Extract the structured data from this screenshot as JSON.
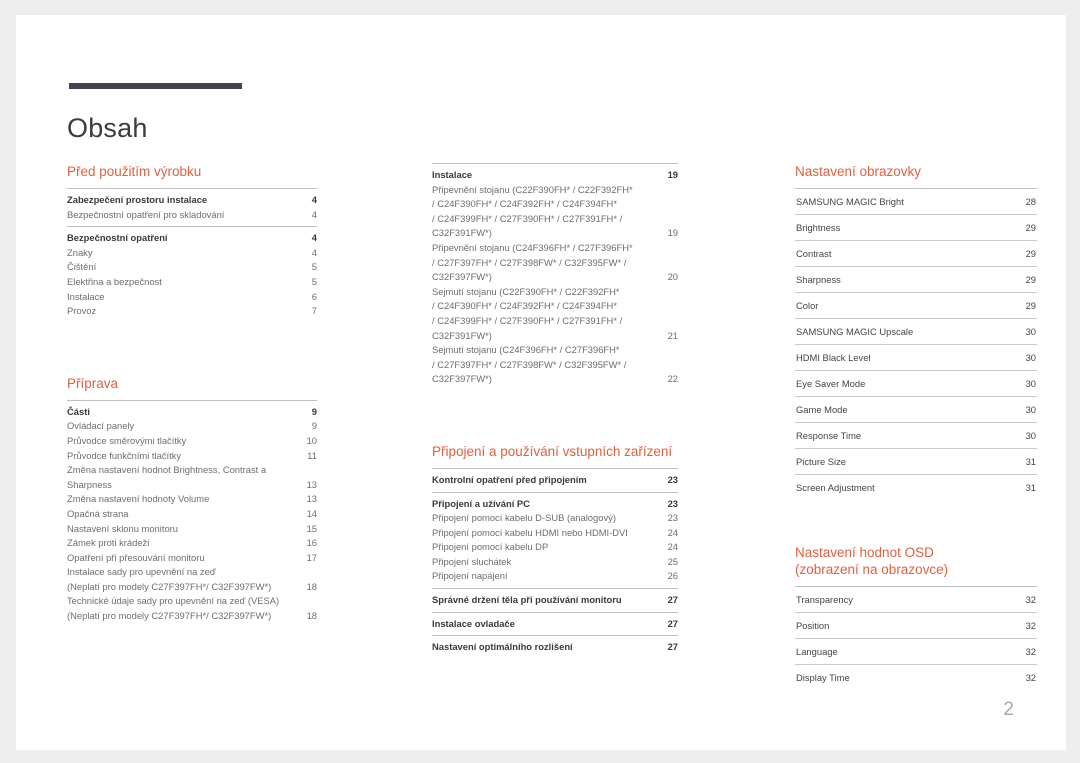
{
  "document": {
    "title": "Obsah",
    "page_number": "2",
    "accent_color": "#e0603d",
    "rule_color": "#464252"
  },
  "columns": [
    {
      "id": "column-1",
      "sections": [
        {
          "heading": "Před použitím výrobku",
          "groups": [
            {
              "entries": [
                {
                  "label": "Zabezpečení prostoru instalace",
                  "page": "4",
                  "level": 1
                },
                {
                  "label": "Bezpečnostní opatření pro skladování",
                  "page": "4",
                  "level": 2
                }
              ]
            },
            {
              "entries": [
                {
                  "label": "Bezpečnostní opatření",
                  "page": "4",
                  "level": 1
                },
                {
                  "label": "Znaky",
                  "page": "4",
                  "level": 2
                },
                {
                  "label": "Čištění",
                  "page": "5",
                  "level": 2
                },
                {
                  "label": "Elektřina a bezpečnost",
                  "page": "5",
                  "level": 2
                },
                {
                  "label": "Instalace",
                  "page": "6",
                  "level": 2
                },
                {
                  "label": "Provoz",
                  "page": "7",
                  "level": 2
                }
              ]
            }
          ]
        },
        {
          "heading": "Příprava",
          "groups": [
            {
              "entries": [
                {
                  "label": "Části",
                  "page": "9",
                  "level": 1
                },
                {
                  "label": "Ovládací panely",
                  "page": "9",
                  "level": 2
                },
                {
                  "label": "Průvodce směrovými tlačítky",
                  "page": "10",
                  "level": 2
                },
                {
                  "label": "Průvodce funkčními tlačítky",
                  "page": "11",
                  "level": 2
                },
                {
                  "label": "Změna nastavení hodnot Brightness, Contrast a\nSharpness",
                  "page": "13",
                  "level": 2
                },
                {
                  "label": "Změna nastavení hodnoty Volume",
                  "page": "13",
                  "level": 2
                },
                {
                  "label": "Opačná strana",
                  "page": "14",
                  "level": 2
                },
                {
                  "label": "Nastavení sklonu monitoru",
                  "page": "15",
                  "level": 2
                },
                {
                  "label": "Zámek proti krádeži",
                  "page": "16",
                  "level": 2
                },
                {
                  "label": "Opatření při přesouvání monitoru",
                  "page": "17",
                  "level": 2
                },
                {
                  "label": "Instalace sady pro upevnění na zeď\n(Neplatí pro modely C27F397FH*/ C32F397FW*)",
                  "page": "18",
                  "level": 2
                },
                {
                  "label": "Technické údaje sady pro upevnění na zeď (VESA)\n(Neplatí pro modely C27F397FH*/ C32F397FW*)",
                  "page": "18",
                  "level": 2
                }
              ]
            }
          ]
        }
      ]
    },
    {
      "id": "column-2",
      "sections": [
        {
          "heading": "",
          "groups": [
            {
              "entries": [
                {
                  "label": "Instalace",
                  "page": "19",
                  "level": 1
                },
                {
                  "label": "Připevnění stojanu (C22F390FH* / C22F392FH*\n/ C24F390FH* / C24F392FH* / C24F394FH*\n/ C24F399FH* / C27F390FH* / C27F391FH* /\nC32F391FW*)",
                  "page": "19",
                  "level": 2
                },
                {
                  "label": "Připevnění stojanu (C24F396FH* / C27F396FH*\n/ C27F397FH* / C27F398FW* / C32F395FW* /\nC32F397FW*)",
                  "page": "20",
                  "level": 2
                },
                {
                  "label": "Sejmutí stojanu (C22F390FH* / C22F392FH*\n/ C24F390FH* / C24F392FH* / C24F394FH*\n/ C24F399FH* / C27F390FH* / C27F391FH* /\nC32F391FW*)",
                  "page": "21",
                  "level": 2
                },
                {
                  "label": "Sejmutí stojanu (C24F396FH* / C27F396FH*\n/ C27F397FH* / C27F398FW* / C32F395FW* /\nC32F397FW*)",
                  "page": "22",
                  "level": 2
                }
              ]
            }
          ]
        },
        {
          "heading": "Připojení a používání vstupních zařízení",
          "groups": [
            {
              "entries": [
                {
                  "label": "Kontrolní opatření před připojením",
                  "page": "23",
                  "level": 1
                }
              ]
            },
            {
              "entries": [
                {
                  "label": "Připojení a užívání PC",
                  "page": "23",
                  "level": 1
                },
                {
                  "label": "Připojení pomocí kabelu D-SUB (analogový)",
                  "page": "23",
                  "level": 2
                },
                {
                  "label": "Připojení pomocí kabelu HDMI nebo HDMI-DVI",
                  "page": "24",
                  "level": 2
                },
                {
                  "label": "Připojení pomocí kabelu DP",
                  "page": "24",
                  "level": 2
                },
                {
                  "label": "Připojení sluchátek",
                  "page": "25",
                  "level": 2
                },
                {
                  "label": "Připojení napájení",
                  "page": "26",
                  "level": 2
                }
              ]
            },
            {
              "entries": [
                {
                  "label": "Správné držení těla při používání monitoru",
                  "page": "27",
                  "level": 1
                }
              ]
            },
            {
              "entries": [
                {
                  "label": "Instalace ovladače",
                  "page": "27",
                  "level": 1
                }
              ]
            },
            {
              "entries": [
                {
                  "label": "Nastavení optimálního rozlišení",
                  "page": "27",
                  "level": 1
                }
              ]
            }
          ]
        }
      ]
    },
    {
      "id": "column-3",
      "sections": [
        {
          "heading": "Nastavení obrazovky",
          "rows": [
            {
              "label": "SAMSUNG MAGIC Bright",
              "page": "28"
            },
            {
              "label": "Brightness",
              "page": "29"
            },
            {
              "label": "Contrast",
              "page": "29"
            },
            {
              "label": "Sharpness",
              "page": "29"
            },
            {
              "label": "Color",
              "page": "29"
            },
            {
              "label": "SAMSUNG MAGIC Upscale",
              "page": "30"
            },
            {
              "label": "HDMI Black Level",
              "page": "30"
            },
            {
              "label": "Eye Saver Mode",
              "page": "30"
            },
            {
              "label": "Game Mode",
              "page": "30"
            },
            {
              "label": "Response Time",
              "page": "30"
            },
            {
              "label": "Picture Size",
              "page": "31"
            },
            {
              "label": "Screen Adjustment",
              "page": "31"
            }
          ]
        },
        {
          "heading": "Nastavení hodnot OSD\n(zobrazení na obrazovce)",
          "rows": [
            {
              "label": "Transparency",
              "page": "32"
            },
            {
              "label": "Position",
              "page": "32"
            },
            {
              "label": "Language",
              "page": "32"
            },
            {
              "label": "Display Time",
              "page": "32"
            }
          ]
        }
      ]
    }
  ]
}
